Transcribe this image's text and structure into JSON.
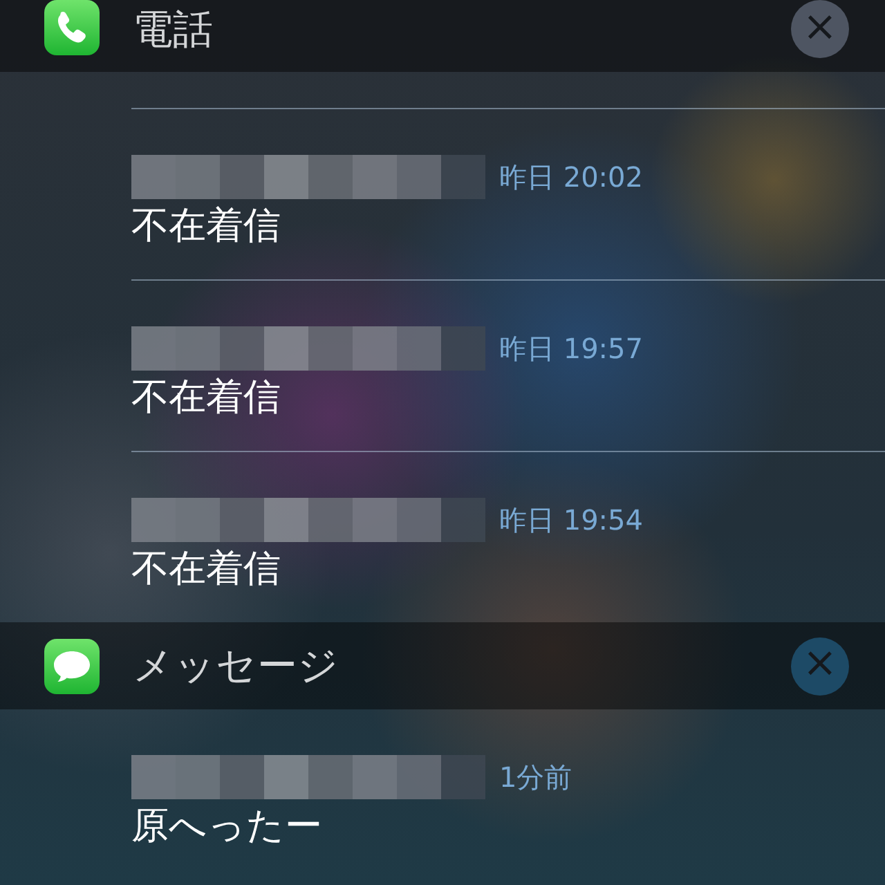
{
  "groups": [
    {
      "app": "電話",
      "kind": "phone",
      "close_button": {
        "label": "×",
        "color": "#4e5562"
      },
      "notifications": [
        {
          "time": "昨日 20:02",
          "text": "不在着信"
        },
        {
          "time": "昨日 19:57",
          "text": "不在着信"
        },
        {
          "time": "昨日 19:54",
          "text": "不在着信"
        }
      ]
    },
    {
      "app": "メッセージ",
      "kind": "messages",
      "close_button": {
        "label": "×",
        "color": "#1d4a66"
      },
      "notifications": [
        {
          "time": "1分前",
          "text": "原へったー"
        }
      ]
    }
  ]
}
